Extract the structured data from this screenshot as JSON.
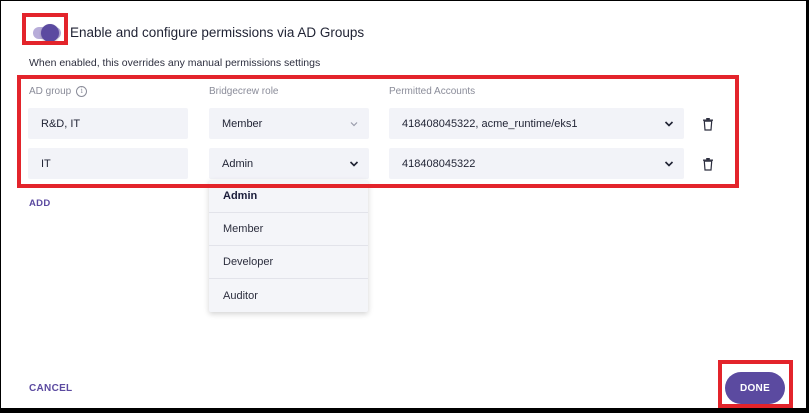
{
  "toggle": {
    "label": "Enable and configure permissions via AD Groups",
    "enabled": true,
    "helper": "When enabled, this overrides any manual permissions settings"
  },
  "columns": {
    "ad_group": "AD group",
    "role": "Bridgecrew role",
    "accounts": "Permitted Accounts"
  },
  "rows": [
    {
      "ad_group": "R&D, IT",
      "role": "Member",
      "accounts": "418408045322, acme_runtime/eks1"
    },
    {
      "ad_group": "IT",
      "role": "Admin",
      "accounts": "418408045322"
    }
  ],
  "role_menu": {
    "open_for_row": 1,
    "selected": "Admin",
    "options": [
      "Admin",
      "Member",
      "Developer",
      "Auditor"
    ]
  },
  "actions": {
    "add": "ADD",
    "cancel": "CANCEL",
    "done": "DONE"
  },
  "colors": {
    "accent": "#5b4aa0",
    "annotation": "#e3242b",
    "field_bg": "#f2f3f8"
  },
  "icons": [
    "info-icon",
    "chevron-down-icon",
    "trash-icon"
  ]
}
